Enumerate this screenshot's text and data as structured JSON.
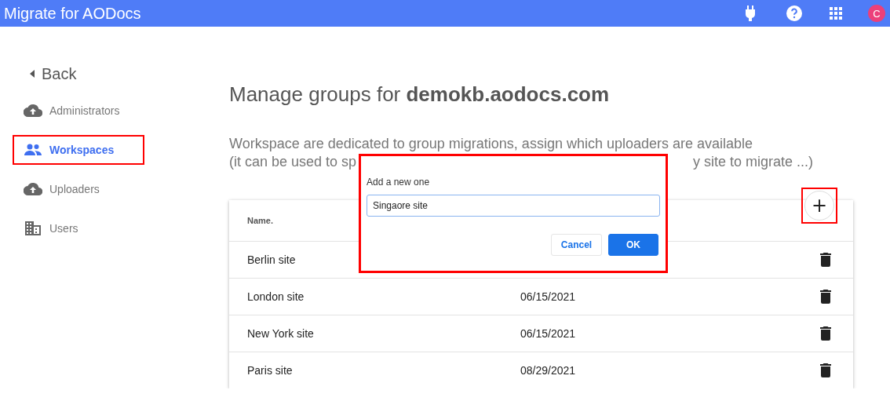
{
  "app_bar": {
    "title": "Migrate for AODocs",
    "avatar": "C"
  },
  "sidebar": {
    "back": "Back",
    "items": [
      {
        "label": "Administrators",
        "kind": "cloud",
        "selected": false,
        "highlighted": false
      },
      {
        "label": "Workspaces",
        "kind": "people",
        "selected": true,
        "highlighted": true
      },
      {
        "label": "Uploaders",
        "kind": "cloud",
        "selected": false,
        "highlighted": false
      },
      {
        "label": "Users",
        "kind": "building",
        "selected": false,
        "highlighted": false
      }
    ]
  },
  "heading": "Manage groups for **demokb.aodocs.com**",
  "description": {
    "line_1": "Workspace are dedicated to group migrations, assign which uploaders are available",
    "line_2_start": "(it can be used to sp",
    "line_2_end": "y site to migrate ...)"
  },
  "table": {
    "columns": [
      "Name."
    ],
    "add_button": {
      "label": "+",
      "highlighted": true
    },
    "rows": [
      {
        "name": "Berlin site"
      },
      {
        "name": "London site",
        "date": "06/15/2021"
      },
      {
        "name": "New York site",
        "date": "06/15/2021"
      },
      {
        "name": "Paris site",
        "date": "08/29/2021"
      }
    ]
  },
  "dialog": {
    "label": "Add a new one",
    "value": "Singaore site",
    "highlighted": true,
    "buttons": [
      {
        "label": "Cancel",
        "kind": "secondary"
      },
      {
        "label": "OK",
        "kind": "primary"
      }
    ]
  }
}
